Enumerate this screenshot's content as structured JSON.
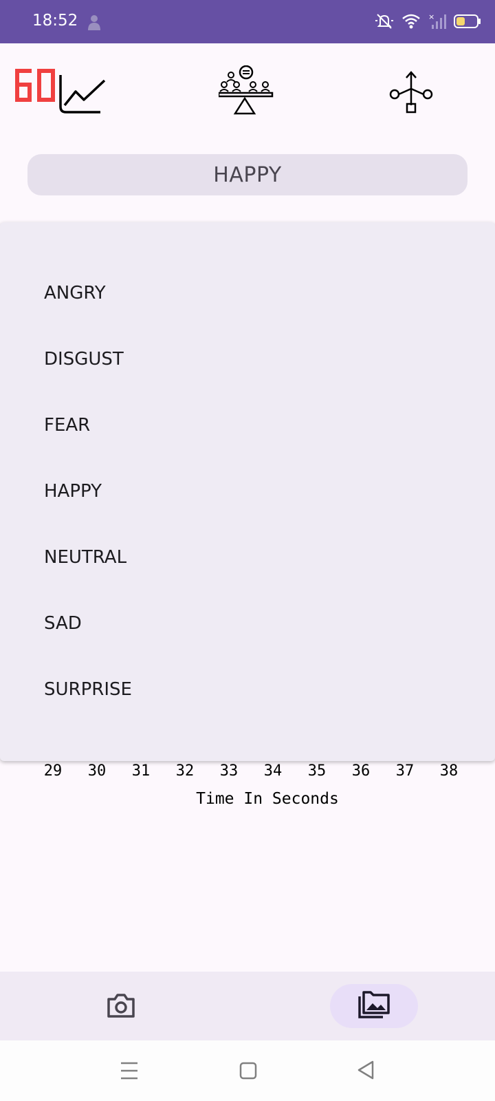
{
  "status_bar": {
    "time": "18:52",
    "background": "#6650a4"
  },
  "header": {
    "fps_counter": "60",
    "fps_color": "#f04040",
    "icons": [
      "chart-line-icon",
      "balance-meeting-icon",
      "usb-share-icon"
    ]
  },
  "dropdown": {
    "selected": "HAPPY",
    "options": [
      "ANGRY",
      "DISGUST",
      "FEAR",
      "HAPPY",
      "NEUTRAL",
      "SAD",
      "SURPRISE"
    ]
  },
  "chart": {
    "x_ticks": [
      "29",
      "30",
      "31",
      "32",
      "33",
      "34",
      "35",
      "36",
      "37",
      "38"
    ],
    "x_label": "Time In Seconds"
  },
  "bottom_nav": {
    "items": [
      "camera-icon",
      "gallery-icon"
    ],
    "selected": "gallery-icon",
    "selected_color": "#e8def8"
  }
}
